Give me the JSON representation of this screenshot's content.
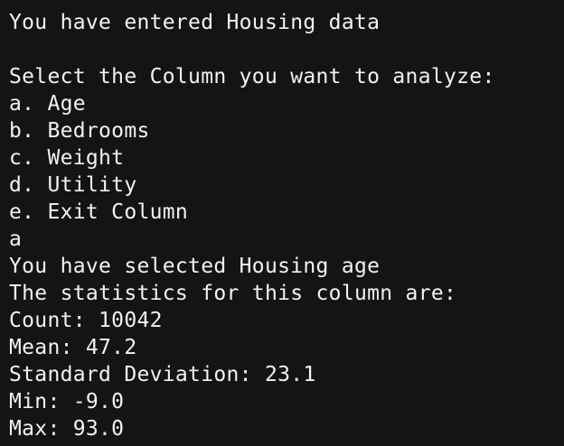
{
  "terminal": {
    "lines": [
      "You have entered Housing data",
      "",
      "Select the Column you want to analyze:",
      "a. Age",
      "b. Bedrooms",
      "c. Weight",
      "d. Utility",
      "e. Exit Column",
      "a",
      "You have selected Housing age",
      "The statistics for this column are:",
      "Count: 10042",
      "Mean: 47.2",
      "Standard Deviation: 23.1",
      "Min: -9.0",
      "Max: 93.0"
    ]
  },
  "colors": {
    "background": "#141414",
    "text": "#f2f2f2"
  }
}
